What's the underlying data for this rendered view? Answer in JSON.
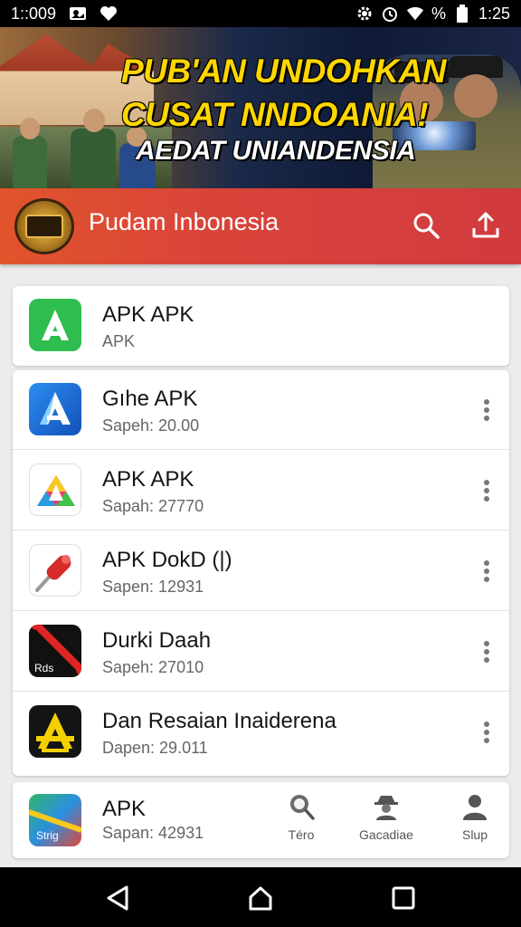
{
  "status_bar": {
    "time": "1::009",
    "battery_text": "%",
    "right_time": "1:25"
  },
  "banner": {
    "line1": "PUB'AN UNDOHKAN",
    "line2": "CUSAT NNDOANIA!",
    "line3": "AEDAT UNIANDENSIA"
  },
  "app_bar": {
    "title": "Pudam Inbonesia"
  },
  "featured": {
    "title": "APK APK",
    "subtitle": "APK"
  },
  "apps": [
    {
      "title": "Gıhe APK",
      "subtitle": "Sapeh: 20.00",
      "icon": "blue-a-icon"
    },
    {
      "title": "APK APK",
      "subtitle": "Sapah: 27770",
      "icon": "rainbow-triangle-icon"
    },
    {
      "title": "APK DokD (|)",
      "subtitle": "Sapen: 12931",
      "icon": "red-pin-icon"
    },
    {
      "title": "Durki Daah",
      "subtitle": "Sapeh: 27010",
      "icon": "black-red-stripe-icon"
    },
    {
      "title": "Dan Resaian Inaiderena",
      "subtitle": "Dapen: 29.011",
      "icon": "yellow-a-icon"
    }
  ],
  "bottom_card": {
    "title": "APK",
    "subtitle": "Sapan: 42931",
    "icon_text": "Strig",
    "tabs": [
      {
        "label": "Téro",
        "icon": "search-globe-icon"
      },
      {
        "label": "Gacadiae",
        "icon": "spy-icon"
      },
      {
        "label": "Slup",
        "icon": "person-icon"
      }
    ]
  },
  "icon_labels": {
    "red_black": "Rds"
  },
  "colors": {
    "app_bar": "#d9443a",
    "banner_yellow": "#ffd600",
    "green_icon": "#2ebd4e",
    "blue_icon": "#1b6fd6"
  }
}
